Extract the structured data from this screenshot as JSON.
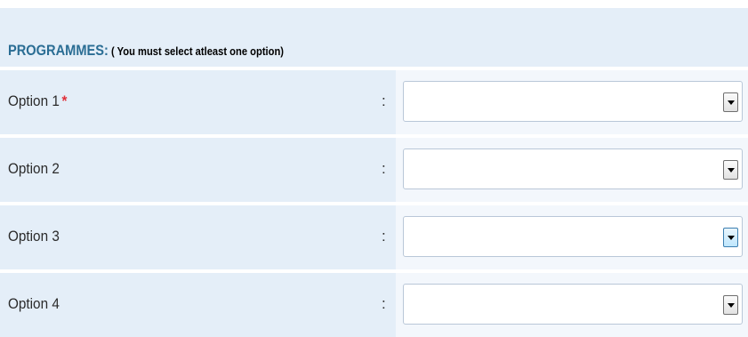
{
  "header": {
    "title": "PROGRAMMES:",
    "note": " ( You must select atleast one option)"
  },
  "rows": [
    {
      "label": "Option 1",
      "required": "*",
      "colon": ":",
      "value": ""
    },
    {
      "label": "Option 2",
      "required": "",
      "colon": ":",
      "value": ""
    },
    {
      "label": "Option 3",
      "required": "",
      "colon": ":",
      "value": ""
    },
    {
      "label": "Option 4",
      "required": "",
      "colon": ":",
      "value": ""
    }
  ],
  "icons": {
    "dropdown": "chevron-down-icon"
  },
  "colors": {
    "row_bg": "#e4eef8",
    "title": "#2a6d94",
    "required_star": "#e0303a"
  }
}
